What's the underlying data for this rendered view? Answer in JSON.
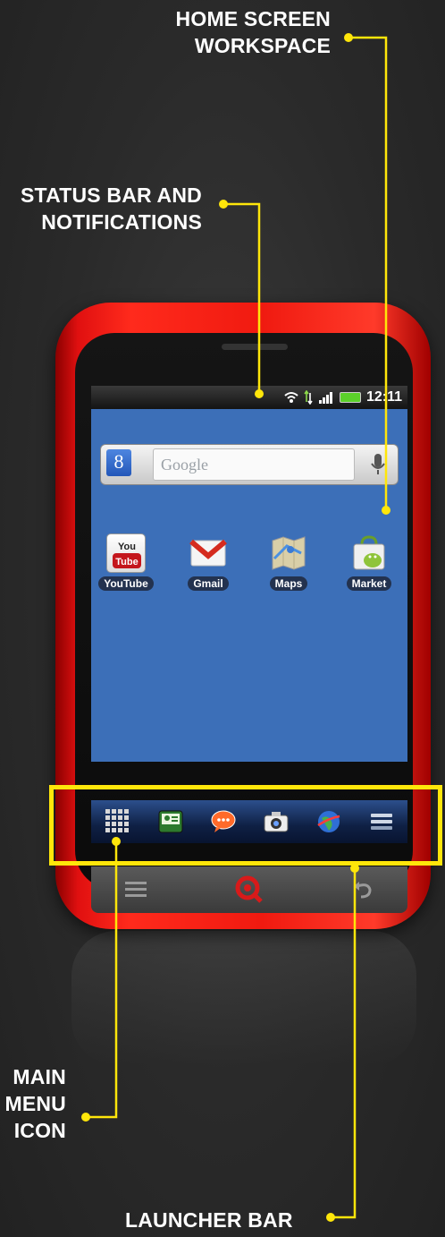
{
  "callouts": {
    "home_screen": [
      "HOME SCREEN",
      "WORKSPACE"
    ],
    "status_bar": [
      "STATUS BAR AND",
      "NOTIFICATIONS"
    ],
    "main_menu": [
      "MAIN",
      "MENU",
      "ICON"
    ],
    "launcher_bar": "LAUNCHER BAR"
  },
  "status_bar": {
    "time": "12:11"
  },
  "search": {
    "logo_letter": "8",
    "placeholder": "Google"
  },
  "apps": [
    {
      "label": "YouTube",
      "icon": "youtube-icon"
    },
    {
      "label": "Gmail",
      "icon": "gmail-icon"
    },
    {
      "label": "Maps",
      "icon": "maps-icon"
    },
    {
      "label": "Market",
      "icon": "market-icon"
    }
  ],
  "launcher": [
    "main-menu-grid-icon",
    "contacts-icon",
    "messaging-icon",
    "camera-icon",
    "browser-globe-icon",
    "settings-list-icon"
  ],
  "nav": [
    "menu-icon",
    "search-logo-icon",
    "back-icon"
  ],
  "colors": {
    "callout_line": "#ffe60a",
    "phone_red": "#f01a10",
    "screen_blue": "#3c6fb8"
  }
}
